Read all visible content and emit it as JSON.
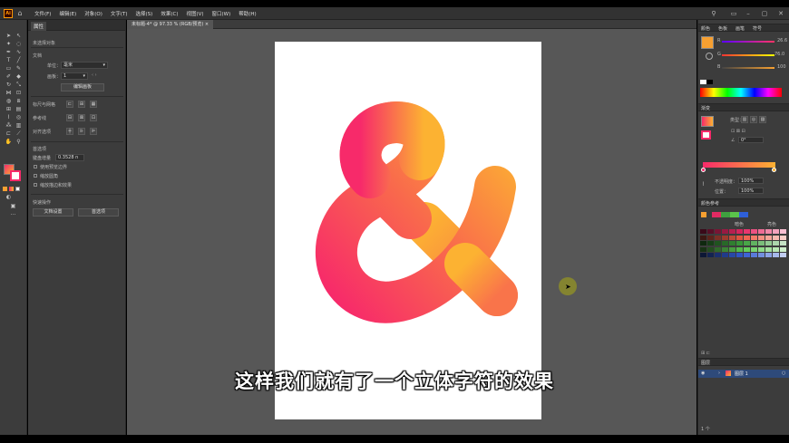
{
  "app": {
    "logo": "Ai"
  },
  "menu": [
    "文件(F)",
    "编辑(E)",
    "对象(O)",
    "文字(T)",
    "选择(S)",
    "效果(C)",
    "视图(V)",
    "窗口(W)",
    "帮助(H)"
  ],
  "document": {
    "tab_label": "未标题-4* @ 97.33 % (RGB/预览)"
  },
  "properties": {
    "tab": "属性",
    "no_selection": "未选择对象",
    "document_section": "文档",
    "unit_label": "单位：",
    "unit_value": "毫米",
    "artboard_label": "画板：",
    "artboard_value": "1",
    "edit_artboard_button": "编辑画板",
    "rulers_grids": "标尺与网格",
    "guides": "参考线",
    "snap": "对齐选项",
    "preferences": "首选项",
    "keyboard_increment_label": "键盘增量",
    "keyboard_increment_value": "0.3528 n",
    "use_preview_bounds": "使用预览边界",
    "scale_corners": "缩放圆角",
    "scale_strokes": "缩放描边和效果",
    "quick_actions": "快速操作",
    "doc_setup_button": "文档设置",
    "preferences_button": "首选项"
  },
  "right": {
    "color_tabs": [
      "颜色",
      "色板",
      "画笔",
      "符号"
    ],
    "color_values": {
      "r": "26.6",
      "g": "76.0",
      "b": "100"
    },
    "gradient_tab": "渐变",
    "gradient_type_label": "类型：",
    "angle_value": "0°",
    "opacity_label": "不透明度：",
    "opacity_value": "100%",
    "location_label": "位置：",
    "location_value": "100%",
    "color_guide_tab": "颜色参考",
    "color_guide_left": "暗色",
    "color_guide_right": "亮色",
    "layers_tab": "图层",
    "layer_name": "图层 1",
    "layer_count": "1 个"
  },
  "subtitle": "这样我们就有了一个立体字符的效果",
  "colors": {
    "gradient_start": "#F72A6A",
    "gradient_end": "#FCB232",
    "fill_swatch": "#F7A031",
    "ui_bg": "#3C3C3C",
    "workspace": "#575757"
  }
}
